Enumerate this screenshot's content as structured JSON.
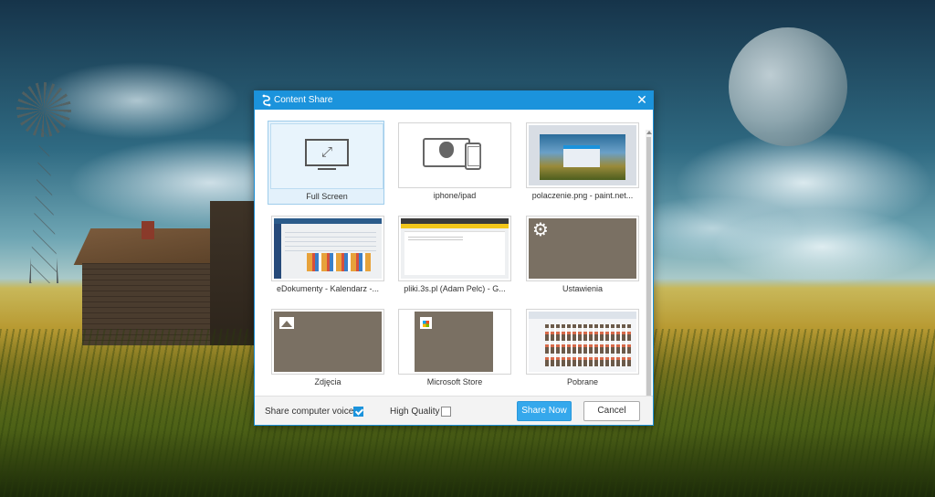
{
  "dialog": {
    "title": "Content Share",
    "app_icon": "content-share-icon",
    "close_icon": "close-icon",
    "close_glyph": "✕"
  },
  "tiles": [
    {
      "label": "Full Screen",
      "kind": "fullscreen",
      "icon": "monitor-fullscreen-icon",
      "selected": true
    },
    {
      "label": "iphone/ipad",
      "kind": "devices",
      "icon": "tablet-phone-apple-icon",
      "selected": false
    },
    {
      "label": "polaczenie.png - paint.net...",
      "kind": "window-thumbnail",
      "selected": false
    },
    {
      "label": "eDokumenty - Kalendarz -...",
      "kind": "window-thumbnail",
      "selected": false
    },
    {
      "label": "pliki.3s.pl (Adam Pelc) - G...",
      "kind": "window-thumbnail",
      "selected": false
    },
    {
      "label": "Ustawienia",
      "kind": "app-thumbnail",
      "icon": "gear-icon",
      "selected": false
    },
    {
      "label": "Zdjęcia",
      "kind": "app-thumbnail",
      "icon": "photos-icon",
      "selected": false
    },
    {
      "label": "Microsoft Store",
      "kind": "app-thumbnail",
      "icon": "store-bag-icon",
      "selected": false
    },
    {
      "label": "Pobrane",
      "kind": "window-thumbnail",
      "selected": false
    }
  ],
  "footer": {
    "share_voice_label": "Share computer voice",
    "share_voice_checked": true,
    "high_quality_label": "High Quality",
    "high_quality_checked": false,
    "share_now_label": "Share Now",
    "cancel_label": "Cancel"
  },
  "colors": {
    "titlebar": "#1b93dc",
    "primary_button": "#35a8ec",
    "selected_tile": "#e3f1fb",
    "app_tile_bg": "#7a7063"
  },
  "glyphs": {
    "gear": "⚙",
    "expand": "⤢"
  }
}
